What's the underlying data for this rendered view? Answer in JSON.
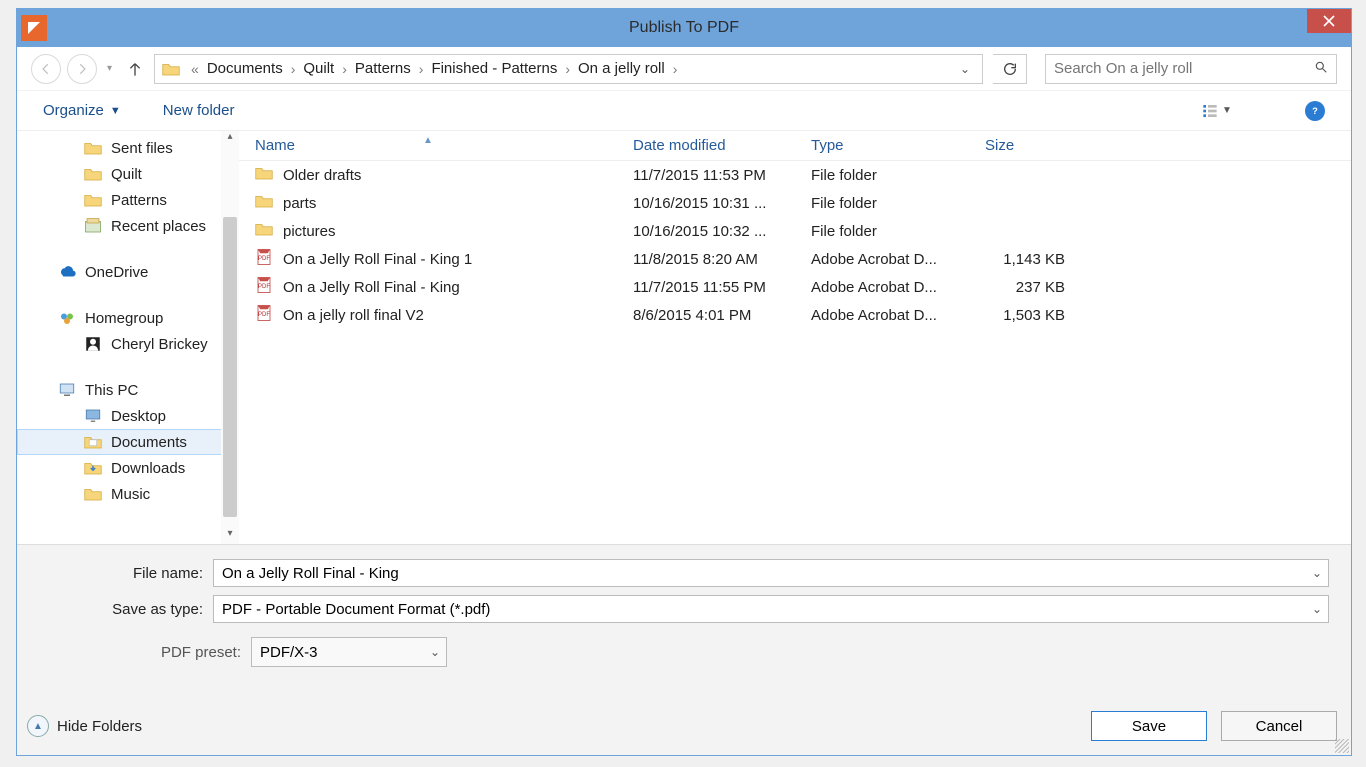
{
  "window": {
    "title": "Publish To PDF"
  },
  "breadcrumb": {
    "prefix": "«",
    "items": [
      "Documents",
      "Quilt",
      "Patterns",
      "Finished - Patterns",
      "On a jelly roll"
    ]
  },
  "search": {
    "placeholder": "Search On a jelly roll"
  },
  "toolbar": {
    "organize": "Organize",
    "new_folder": "New folder"
  },
  "tree": {
    "items": [
      {
        "label": "Sent files",
        "lvl": 2,
        "icon": "folder"
      },
      {
        "label": "Quilt",
        "lvl": 2,
        "icon": "folder"
      },
      {
        "label": "Patterns",
        "lvl": 2,
        "icon": "folder"
      },
      {
        "label": "Recent places",
        "lvl": 2,
        "icon": "recent"
      }
    ],
    "onedrive": "OneDrive",
    "homegroup": "Homegroup",
    "cheryl": "Cheryl Brickey",
    "thispc": "This PC",
    "pc_items": [
      {
        "label": "Desktop"
      },
      {
        "label": "Documents",
        "selected": true
      },
      {
        "label": "Downloads"
      },
      {
        "label": "Music"
      }
    ]
  },
  "columns": {
    "name": "Name",
    "date": "Date modified",
    "type": "Type",
    "size": "Size"
  },
  "rows": [
    {
      "icon": "folder",
      "name": "Older drafts",
      "date": "11/7/2015 11:53 PM",
      "type": "File folder",
      "size": ""
    },
    {
      "icon": "folder",
      "name": "parts",
      "date": "10/16/2015 10:31 ...",
      "type": "File folder",
      "size": ""
    },
    {
      "icon": "folder",
      "name": "pictures",
      "date": "10/16/2015 10:32 ...",
      "type": "File folder",
      "size": ""
    },
    {
      "icon": "pdf",
      "name": "On a Jelly Roll Final - King 1",
      "date": "11/8/2015 8:20 AM",
      "type": "Adobe Acrobat D...",
      "size": "1,143 KB"
    },
    {
      "icon": "pdf",
      "name": "On a Jelly Roll Final - King",
      "date": "11/7/2015 11:55 PM",
      "type": "Adobe Acrobat D...",
      "size": "237 KB"
    },
    {
      "icon": "pdf",
      "name": "On a jelly roll final V2",
      "date": "8/6/2015 4:01 PM",
      "type": "Adobe Acrobat D...",
      "size": "1,503 KB"
    }
  ],
  "form": {
    "filename_label": "File name:",
    "filename_value": "On a Jelly Roll Final - King",
    "saveas_label": "Save as type:",
    "saveas_value": "PDF - Portable Document Format (*.pdf)",
    "preset_label": "PDF preset:",
    "preset_value": "PDF/X-3"
  },
  "footer": {
    "hide": "Hide Folders",
    "save": "Save",
    "cancel": "Cancel"
  }
}
